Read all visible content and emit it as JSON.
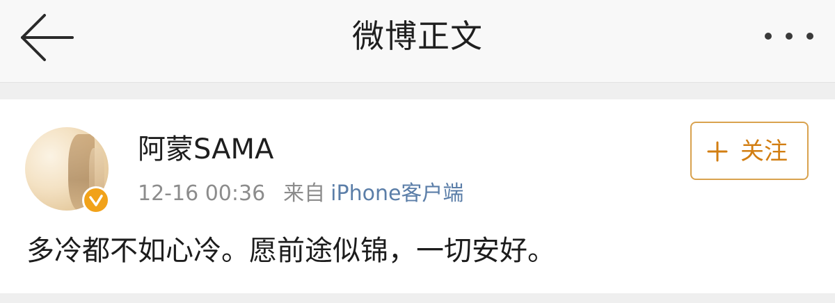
{
  "header": {
    "title": "微博正文",
    "back_icon": "arrow-left-icon",
    "more_icon": "more-dots-icon"
  },
  "post": {
    "username": "阿蒙SAMA",
    "timestamp": "12-16 00:36",
    "source_prefix": "来自",
    "source_device": "iPhone客户端",
    "verified": true,
    "verified_color": "#f1a21a",
    "follow_button": {
      "icon": "plus-icon",
      "label": "关注",
      "color": "#d27e12"
    },
    "text": "多冷都不如心冷。愿前途似锦，一切安好。"
  }
}
